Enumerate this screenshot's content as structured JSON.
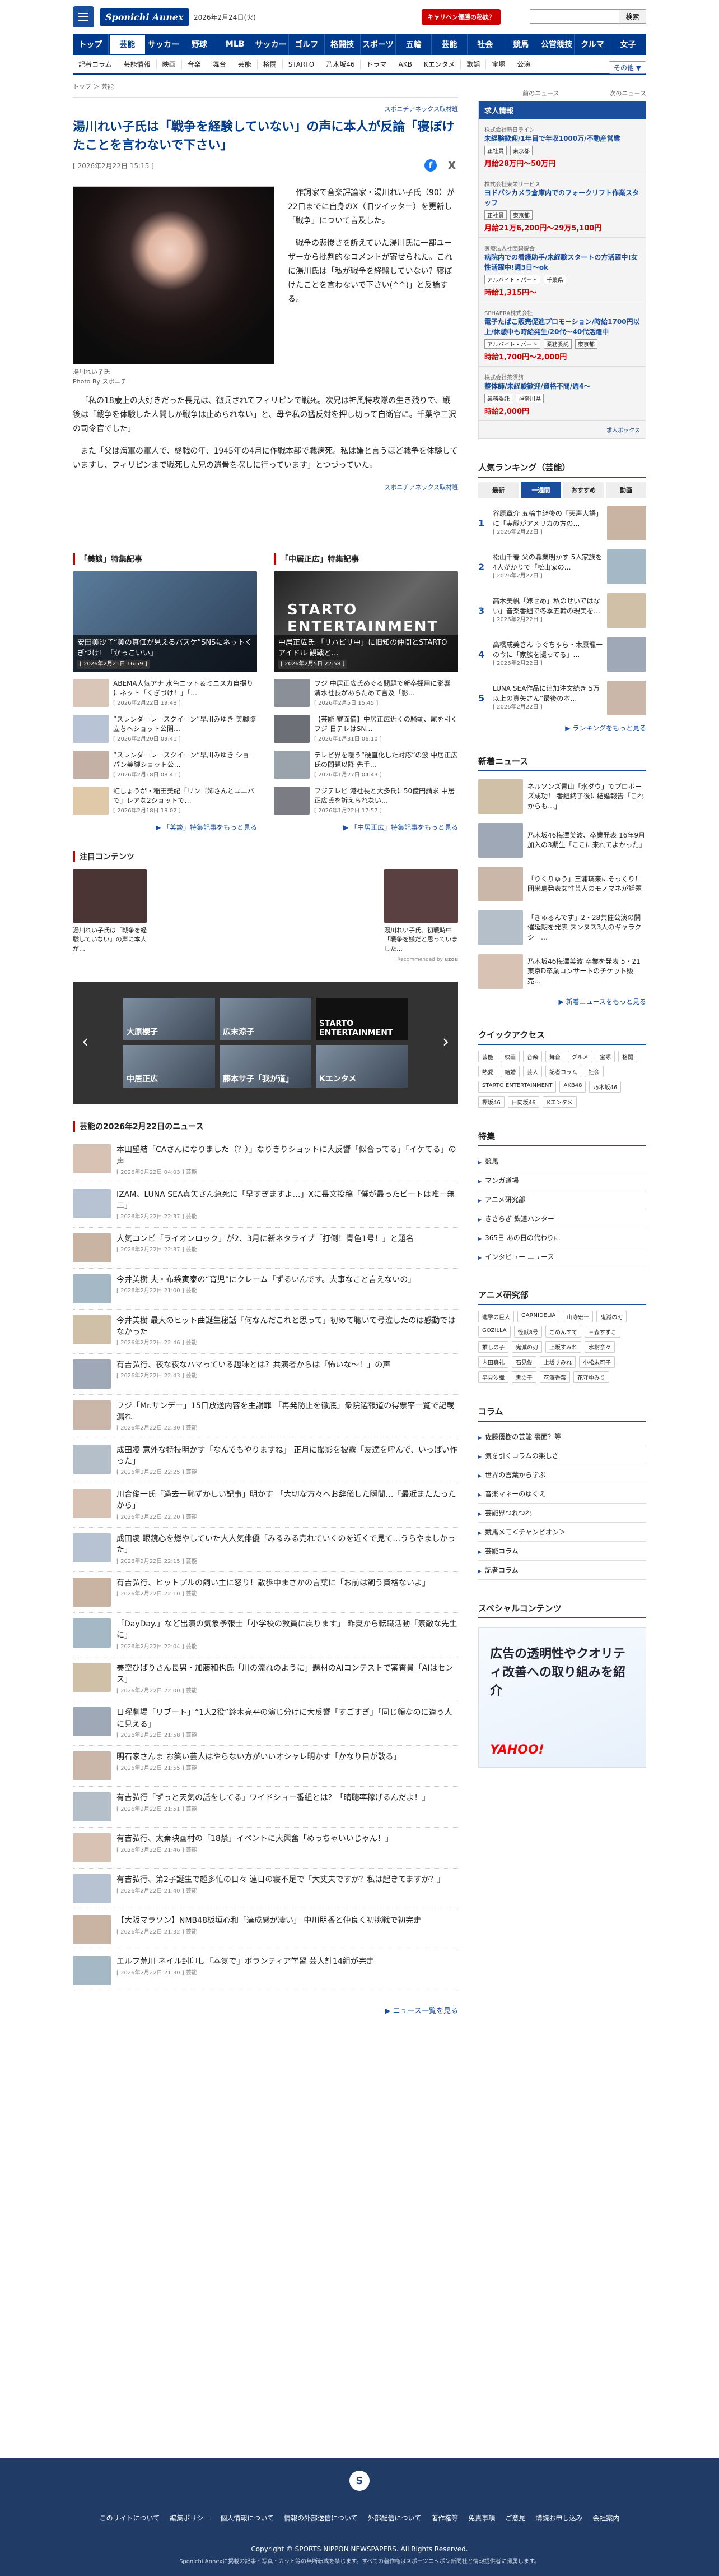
{
  "header": {
    "logo": "Sponichi Annex",
    "date": "2026年2月24日(火)",
    "promo": "キャリペン優勝の秘訣？",
    "search_placeholder": "",
    "search_button": "検索",
    "nav": [
      "トップ",
      "芸能",
      "サッカー",
      "野球",
      "MLB",
      "サッカー",
      "ゴルフ",
      "格闘技",
      "スポーツ",
      "五輪",
      "芸能",
      "社会",
      "競馬",
      "公営競技",
      "クルマ",
      "女子"
    ],
    "subnav": [
      "記者コラム",
      "芸能情報",
      "映画",
      "音楽",
      "舞台",
      "芸能",
      "格闘",
      "STARTO",
      "乃木坂46",
      "ドラマ",
      "AKB",
      "Kエンタメ",
      "歌謡",
      "宝塚",
      "公演",
      "その他"
    ],
    "subnav_more": "その他 ▼"
  },
  "article": {
    "breadcrumb": "トップ ＞ 芸能",
    "prev": "前のニュース",
    "next": "次のニュース",
    "source_label": "スポニチアネックス取材班",
    "title": "湯川れい子氏は「戦争を経験していない」の声に本人が反論「寝ぼけたことを言わないで下さい」",
    "date": "[ 2026年2月22日 15:15 ]",
    "caption": "湯川れい子氏",
    "photo_by": "Photo By スポニチ",
    "p1": "作詞家で音楽評論家・湯川れい子氏（90）が22日までに自身のX（旧ツイッター）を更新し「戦争」について言及した。",
    "p2": "戦争の悲惨さを訴えていた湯川氏に一部ユーザーから批判的なコメントが寄せられた。これに湯川氏は「私が戦争を経験していない？寝ぼけたことを言わないで下さい(^^)」と反論する。",
    "p3": "「私の18歳上の大好きだった長兄は、徴兵されてフィリピンで戦死。次兄は神風特攻隊の生き残りで、戦後は「戦争を体験した人間しか戦争は止められない」と、母や私の猛反対を押し切って自衛官に。千葉や三沢の司令官でした」",
    "p4": "また「父は海軍の軍人で、終戦の年、1945年の4月に作戦本部で戦病死。私は嫌と言うほど戦争を体験していますし、フィリピンまで戦死した兄の遺骨を探しに行っています」とつづっていた。",
    "credit": "スポニチアネックス取材班"
  },
  "features": {
    "left_title": "「美談」特集記事",
    "left_hero": "安田美沙子“美の真価が見えるバスケ”SNSにネットくぎづけ！「かっこいい」",
    "left_hero_date": "[ 2026年2月21日 16:59 ]",
    "left_items": [
      {
        "t": "ABEMA人気アナ 水色ニット＆ミニスカ自撮りにネット「くぎづけ！」「…",
        "d": "[ 2026年2月22日 19:48 ]"
      },
      {
        "t": "“スレンダーレースクイーン”早川みゆき 美脚際立ちヘショット公開…",
        "d": "[ 2026年2月20日 09:41 ]"
      },
      {
        "t": "“スレンダーレースクイーン”早川みゆき ショーパン美脚ショット公…",
        "d": "[ 2026年2月18日 08:41 ]"
      },
      {
        "t": "虹しょうが・稲田美紀「リンゴ姉さんとユニバで」レアな2ショットで…",
        "d": "[ 2026年2月18日 18:02 ]"
      }
    ],
    "left_more": "「美談」特集記事をもっと見る",
    "right_title": "「中居正広」特集記事",
    "right_hero": "中居正広氏 「リハビリ中」に旧知の仲間とSTARTOアイドル 観戦と…",
    "right_hero_date": "[ 2026年2月5日 22:58 ]",
    "right_hero_logo": "STARTO ENTERTAINMENT",
    "right_items": [
      {
        "t": "フジ 中居正広氏めぐる問題で新卒採用に影響 清水社長があらためて言及「影…",
        "d": "[ 2026年2月5日 15:45 ]"
      },
      {
        "t": "【芸能 審面備】中居正広近くの騒動、尾を引くフジ 日テレはSN…",
        "d": "[ 2026年1月31日 06:10 ]"
      },
      {
        "t": "テレビ界を覆う“硬直化した対応”の波 中居正広氏の問題以降 先手…",
        "d": "[ 2026年1月27日 04:43 ]"
      },
      {
        "t": "フジテレビ 港社長と大多氏に50億円請求 中居正広氏を訴えられない…",
        "d": "[ 2026年1月22日 17:57 ]"
      }
    ],
    "right_more": "「中居正広」特集記事をもっと見る"
  },
  "notice": {
    "title": "注目コンテンツ",
    "items": [
      "湯川れい子氏は「戦争を経験していない」の声に本人が…",
      "湯川れい子氏、初戦時中「戦争を嫌だと思っていました…"
    ],
    "ad_label": "Recommended by"
  },
  "carousel": [
    "大原櫻子",
    "広末涼子",
    "STARTO ENTERTAINMENT",
    "中居正広",
    "藤本サ子「我が道」",
    "Kエンタメ"
  ],
  "news": {
    "title": "芸能の2026年2月22日のニュース",
    "items": [
      {
        "t": "本田望結「CAさんになりました（？）」なりきりショットに大反響「似合ってる」「イケてる」の声",
        "d": "[ 2026年2月22日 04:03 ] 芸能"
      },
      {
        "t": "IZAM、LUNA SEA真矢さん急死に「早すぎますよ…」Xに長文投稿「僕が最ったビートは唯一無二」",
        "d": "[ 2026年2月22日 22:37 ] 芸能"
      },
      {
        "t": "人気コンビ「ライオンロック」が2、3月に新ネタライブ「打倒！青色1号！」と題名",
        "d": "[ 2026年2月22日 22:37 ] 芸能"
      },
      {
        "t": "今井美樹 夫・布袋寅泰の“育児”にクレーム「ずるいんです。大事なこと言えないの」",
        "d": "[ 2026年2月22日 21:00 ] 芸能"
      },
      {
        "t": "今井美樹 最大のヒット曲誕生秘話「何なんだこれと思って」初めて聴いて号泣したのは感動ではなかった",
        "d": "[ 2026年2月22日 22:46 ] 芸能"
      },
      {
        "t": "有吉弘行、夜な夜なハマっている趣味とは？共演者からは「怖いな～！」の声",
        "d": "[ 2026年2月22日 22:43 ] 芸能"
      },
      {
        "t": "フジ「Mr.サンデー」15日放送内容を主謝罪 「再発防止を徹底」衆院選報道の得票率一覧で記載漏れ",
        "d": "[ 2026年2月22日 22:30 ] 芸能"
      },
      {
        "t": "成田凌 意外な特技明かす「なんでもやりますね」 正月に撮影を披露「友達を呼んで、いっぱい作った」",
        "d": "[ 2026年2月22日 22:25 ] 芸能"
      },
      {
        "t": "川合俊一氏「過去一恥ずかしい記事」明かす 「大切な方々へお辞儀した瞬間…「最近またたったから」",
        "d": "[ 2026年2月22日 22:20 ] 芸能"
      },
      {
        "t": "成田凌 眼鏡心を燃やしていた大人気俳優「みるみる売れていくのを近くで見て…うらやましかった」",
        "d": "[ 2026年2月22日 22:15 ] 芸能"
      },
      {
        "t": "有吉弘行、ヒットプルの飼い主に怒り！散歩中まさかの言葉に「お前は飼う資格ないよ」",
        "d": "[ 2026年2月22日 22:10 ] 芸能"
      },
      {
        "t": "「DayDay.」など出演の気象予報士「小学校の教員に戻ります」 昨夏から転職活動「素敵な先生に」",
        "d": "[ 2026年2月22日 22:04 ] 芸能"
      },
      {
        "t": "美空ひばりさん長男・加藤和也氏「川の流れのように」題材のAIコンテストで審査員「AIはセンス」",
        "d": "[ 2026年2月22日 22:00 ] 芸能"
      },
      {
        "t": "日曜劇場「リブート」“1人2役”鈴木亮平の演じ分けに大反響「すごすぎ」「同じ顔なのに違う人に見える」",
        "d": "[ 2026年2月22日 21:58 ] 芸能"
      },
      {
        "t": "明石家さんま お笑い芸人はやらない方がいいオシャレ明かす「かなり目が散る」",
        "d": "[ 2026年2月22日 21:55 ] 芸能"
      },
      {
        "t": "有吉弘行「ずっと天気の話をしてる」ワイドショー番組とは？「晴聴率稼げるんだよ！」",
        "d": "[ 2026年2月22日 21:51 ] 芸能"
      },
      {
        "t": "有吉弘行、太秦映画村の「18禁」イベントに大興奮「めっちゃいいじゃん！」",
        "d": "[ 2026年2月22日 21:46 ] 芸能"
      },
      {
        "t": "有吉弘行、第2子誕生で超多忙の日々 連日の寝不足で「大丈夫ですか？私は起きてますか？」",
        "d": "[ 2026年2月22日 21:40 ] 芸能"
      },
      {
        "t": "【大阪マラソン】NMB48板垣心和「達成感が凄い」 中川朋香と仲良く初挑戦で初完走",
        "d": "[ 2026年2月22日 21:32 ] 芸能"
      },
      {
        "t": "エルフ荒川 ネイル封印し「本気で」ボランティア学習 芸人計14組が完走",
        "d": "[ 2026年2月22日 21:30 ] 芸能"
      }
    ],
    "more": "ニュース一覧を見る"
  },
  "jobs": {
    "header": "求人情報",
    "items": [
      {
        "t": "未経験歓迎/1年目で年収1000万/不動産営業",
        "c": "株式会社新日ライン",
        "tags": [
          "正社員",
          "東京都"
        ],
        "s": "月給28万円～50万円"
      },
      {
        "t": "ヨドバシカメラ倉庫内でのフォークリフト作業スタッフ",
        "c": "株式会社東栄サービス",
        "tags": [
          "正社員",
          "東京都"
        ],
        "s": "月給21万6,200円～29万5,100円"
      },
      {
        "t": "病院内での看護助手/未経験スタートの方活躍中!女性活躍中!週3日～ok",
        "c": "医療法人社団碧鋭会",
        "tags": [
          "アルバイト・パート",
          "千葉県"
        ],
        "s": "時給1,315円～"
      },
      {
        "t": "電子たばこ販売促進プロモーション/時給1700円以上/休憩中も時給発生/20代～40代活躍中",
        "c": "SPHAERA株式会社",
        "tags": [
          "アルバイト・パート",
          "業務委託",
          "東京都"
        ],
        "s": "時給1,700円～2,000円"
      },
      {
        "t": "整体師/未経験歓迎/資格不問/週4～",
        "c": "株式会社茶漂館",
        "tags": [
          "業務委託",
          "神奈川県"
        ],
        "s": "時給2,000円"
      }
    ],
    "brand": "求人ボックス"
  },
  "ranking": {
    "title": "人気ランキング（芸能）",
    "tabs": [
      "最新",
      "一週間",
      "おすすめ",
      "動画"
    ],
    "items": [
      {
        "n": "1",
        "t": "谷原章介 五輪中継後の「天声人語」に「実態がアメリカの方の…",
        "d": "[ 2026年2月22日 ]"
      },
      {
        "n": "2",
        "t": "松山千春 父の職業明かす 5人家族を4人がかりで「松山家の…",
        "d": "[ 2026年2月22日 ]"
      },
      {
        "n": "3",
        "t": "高木美帆「嫁せめ」私のせいではない」音楽番組で冬季五輪の現実を…",
        "d": "[ 2026年2月22日 ]"
      },
      {
        "n": "4",
        "t": "高橋成美さん うぐちゃら・木原龍一の今に「家族を撮ってる」…",
        "d": "[ 2026年2月22日 ]"
      },
      {
        "n": "5",
        "t": "LUNA SEA作品に追加注文続き 5万以上の真矢さん“最後の本…",
        "d": "[ 2026年2月22日 ]"
      }
    ],
    "more": "ランキングをもっと見る"
  },
  "latest": {
    "title": "新着ニュース",
    "items": [
      "ネルソンズ青山「氷ダウ」でプロボーズ成功！ 番組終了後に結婚報告「これからも…」",
      "乃木坂46梅澤美波、卒業発表 16年9月加入の3期生「ここに来れてよかった」",
      "「りくりゅう」三浦璃来にそっくり！ 囲米島発表女性芸人のモノマネが話題",
      "「きゅるんです」2・28共催公演の開催延期を発表 ヌンヌス3人のギャラクシー…",
      "乃木坂46梅澤美波 卒業を発表 5・21東京D卒業コンサートのチケット販売…"
    ],
    "more": "新着ニュースをもっと見る"
  },
  "quick": {
    "title": "クイックアクセス",
    "chips": [
      "芸能",
      "映画",
      "音楽",
      "舞台",
      "グルメ",
      "宝塚",
      "格闘",
      "熱愛",
      "結婚",
      "芸人",
      "記者コラム",
      "社会",
      "STARTO ENTERTAINMENT",
      "AKB48",
      "乃木坂46",
      "欅坂46",
      "日向坂46",
      "Kエンタメ"
    ]
  },
  "special": {
    "title": "特集",
    "items": [
      "競馬",
      "マンガ道場",
      "アニメ研究部",
      "きさらぎ 鉄道ハンター",
      "365日 あの日の代わりに",
      "インタビュー ニュース"
    ]
  },
  "anime": {
    "title": "アニメ研究部",
    "chips": [
      "進撃の巨人",
      "GARNIDELIA",
      "山寺宏一",
      "鬼滅の刃",
      "GOZILLA",
      "怪獣8号",
      "ごめんすて",
      "三森すずこ",
      "推しの子",
      "鬼滅の刃",
      "上坂すみれ",
      "水樹奈々",
      "内田真礼",
      "石見俊",
      "上坂すみれ",
      "小松未可子",
      "早見沙織",
      "鬼の子",
      "花澤香菜",
      "花守ゆみり"
    ]
  },
  "column": {
    "title": "コラム",
    "items": [
      "佐藤優樹の芸能 裏面？等",
      "気を引くコラムの楽しさ",
      "世界の言葉から学ぶ",
      "音楽マネーのゆくえ",
      "芸能界つれつれ",
      "競馬メモ＜チャンピオン＞",
      "芸能コラム",
      "記者コラム"
    ]
  },
  "sp": {
    "title": "スペシャルコンテンツ",
    "ad_text": "広告の透明性やクオリティ改善への取り組みを紹介",
    "ad_brand": "YAHOO!"
  },
  "footer": {
    "logo": "S",
    "nav": [
      "このサイトについて",
      "編集ポリシー",
      "個人情報について",
      "情報の外部送信について",
      "外部配信について",
      "著作権等",
      "免責事項",
      "ご意見",
      "購読お申し込み",
      "会社案内"
    ],
    "copy": "Copyright © SPORTS NIPPON NEWSPAPERS. All Rights Reserved.",
    "sub": "Sponichi Annexに掲載の記事・写真・カット等の無断転載を禁じます。すべての著作権はスポーツニッポン新聞社と情報提供者に帰属します。"
  }
}
